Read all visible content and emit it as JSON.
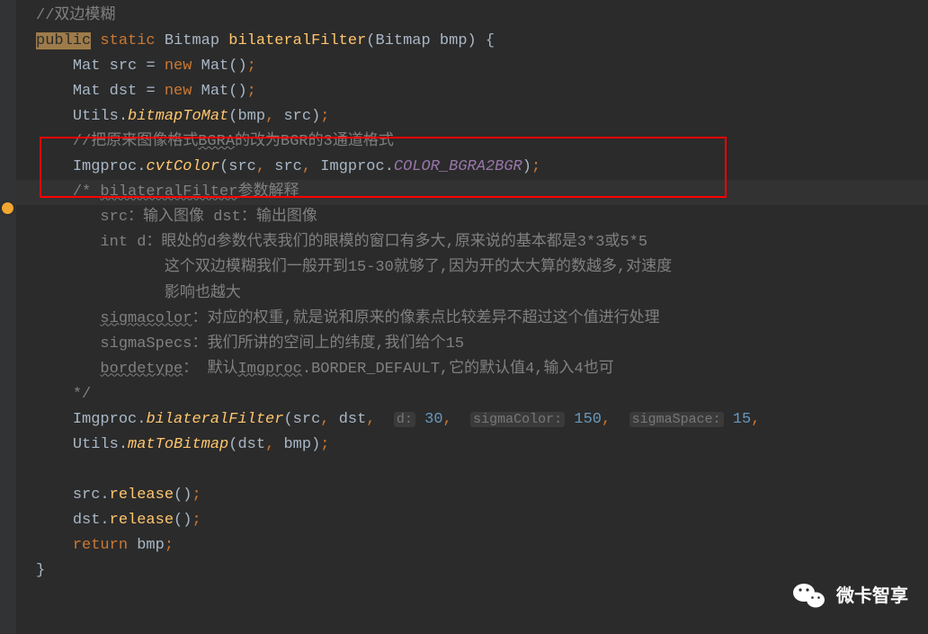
{
  "code": {
    "comment_top": "//双边模糊",
    "kw_public": "public",
    "kw_static": "static",
    "type_bitmap": "Bitmap",
    "method_name": "bilateralFilter",
    "param_type": "Bitmap",
    "param_name": "bmp",
    "mat_src_decl_type": "Mat",
    "mat_src_name": "src",
    "kw_new": "new",
    "mat_ctor": "Mat",
    "mat_dst_name": "dst",
    "utils_class": "Utils",
    "bitmapToMat": "bitmapToMat",
    "comment_bgra": "//把原来图像格式",
    "comment_bgra_word": "BGRA",
    "comment_bgra_rest": "的改为BGR的3通道格式",
    "imgproc_class": "Imgproc",
    "cvtColor": "cvtColor",
    "color_const": "COLOR_BGRA2BGR",
    "block_comment_start": "/* ",
    "block_comment_title_word": "bilateralFilter",
    "block_comment_title_rest": "参数解释",
    "bc_line2": "src：输入图像 dst：输出图像",
    "bc_line3": "int d：眼处的d参数代表我们的眼模的窗口有多大,原来说的基本都是3*3或5*5",
    "bc_line4": "这个双边模糊我们一般开到15-30就够了,因为开的太大算的数越多,对速度",
    "bc_line5": "影响也越大",
    "bc_sigmacolor_word": "sigmacolor",
    "bc_sigmacolor_rest": "：对应的权重,就是说和原来的像素点比较差异不超过这个值进行处理",
    "bc_sigmaspecs": "sigmaSpecs：我们所讲的空间上的纬度,我们给个15",
    "bc_bordetype_word": "bordetype",
    "bc_bordetype_rest": "： 默认",
    "bc_bordetype_word2": "Imgproc",
    "bc_bordetype_rest2": ".BORDER_DEFAULT,它的默认值4,输入4也可",
    "block_comment_end": "*/",
    "bf_method": "bilateralFilter",
    "hint_d": "d:",
    "val_d": "30",
    "hint_sigmaColor": "sigmaColor:",
    "val_sigmaColor": "150",
    "hint_sigmaSpace": "sigmaSpace:",
    "val_sigmaSpace": "15",
    "matToBitmap": "matToBitmap",
    "release": "release",
    "kw_return": "return"
  },
  "watermark": {
    "text": "微卡智享"
  }
}
